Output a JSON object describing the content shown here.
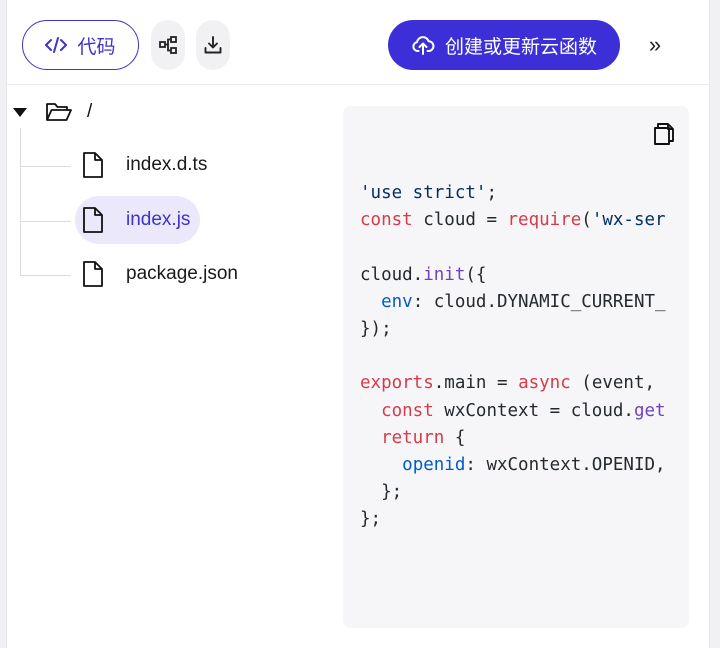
{
  "toolbar": {
    "code_label": "代码",
    "deploy_label": "创建或更新云函数",
    "more_label": "»"
  },
  "tree": {
    "root_label": "/",
    "files": [
      {
        "name": "index.d.ts",
        "active": false
      },
      {
        "name": "index.js",
        "active": true
      },
      {
        "name": "package.json",
        "active": false
      }
    ]
  },
  "code": {
    "lines": [
      [
        {
          "t": "'use strict'",
          "c": "str"
        },
        {
          "t": ";",
          "c": "plain"
        }
      ],
      [
        {
          "t": "const",
          "c": "kw"
        },
        {
          "t": " cloud = ",
          "c": "plain"
        },
        {
          "t": "require",
          "c": "kw"
        },
        {
          "t": "(",
          "c": "plain"
        },
        {
          "t": "'wx-ser",
          "c": "str"
        }
      ],
      [],
      [
        {
          "t": "cloud.",
          "c": "plain"
        },
        {
          "t": "init",
          "c": "fn"
        },
        {
          "t": "({",
          "c": "plain"
        }
      ],
      [
        {
          "t": "  ",
          "c": "plain"
        },
        {
          "t": "env",
          "c": "prop"
        },
        {
          "t": ": cloud.DYNAMIC_CURRENT_",
          "c": "plain"
        }
      ],
      [
        {
          "t": "});",
          "c": "plain"
        }
      ],
      [],
      [
        {
          "t": "exports",
          "c": "kw"
        },
        {
          "t": ".main = ",
          "c": "plain"
        },
        {
          "t": "async",
          "c": "kw"
        },
        {
          "t": " (event, ",
          "c": "plain"
        }
      ],
      [
        {
          "t": "  ",
          "c": "plain"
        },
        {
          "t": "const",
          "c": "kw"
        },
        {
          "t": " wxContext = cloud.",
          "c": "plain"
        },
        {
          "t": "get",
          "c": "fn"
        }
      ],
      [
        {
          "t": "  ",
          "c": "plain"
        },
        {
          "t": "return",
          "c": "kw"
        },
        {
          "t": " {",
          "c": "plain"
        }
      ],
      [
        {
          "t": "    ",
          "c": "plain"
        },
        {
          "t": "openid",
          "c": "prop"
        },
        {
          "t": ": wxContext.OPENID,",
          "c": "plain"
        }
      ],
      [
        {
          "t": "  };",
          "c": "plain"
        }
      ],
      [
        {
          "t": "};",
          "c": "plain"
        }
      ]
    ]
  },
  "colors": {
    "accent": "#3c2fd8",
    "active_bg": "#ebe8fb",
    "keyword": "#d73a49",
    "string": "#032f62",
    "function": "#6f42c1",
    "property": "#005cc5"
  },
  "icons": {
    "code": "code-brackets-icon",
    "tree": "tree-structure-icon",
    "download": "download-icon",
    "upload": "cloud-upload-icon",
    "more": "double-chevron-right-icon",
    "folder": "folder-open-icon",
    "file": "file-icon",
    "copy": "copy-icon"
  }
}
